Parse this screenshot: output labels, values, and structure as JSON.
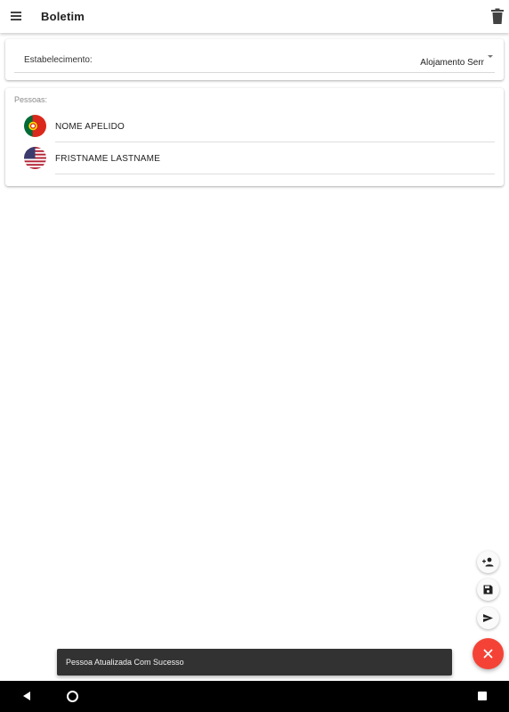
{
  "toolbar": {
    "title": "Boletim",
    "menu_icon": "menu-icon",
    "delete_icon": "trash-icon"
  },
  "establishment": {
    "label": "Estabelecimento:",
    "selected_value": "Alojamento Serr"
  },
  "people": {
    "label": "Pessoas:",
    "items": [
      {
        "name": "NOME APELIDO",
        "flag": "portugal-flag-icon"
      },
      {
        "name": "FRISTNAME LASTNAME",
        "flag": "usa-flag-icon"
      }
    ]
  },
  "fab": {
    "actions": [
      "add-person-icon",
      "save-icon",
      "send-icon"
    ],
    "main_icon": "close-icon",
    "main_color": "#f44336"
  },
  "snackbar": {
    "message": "Pessoa Atualizada Com Sucesso"
  },
  "navbar": {
    "icons": [
      "back-icon",
      "home-icon",
      "recents-icon"
    ]
  }
}
